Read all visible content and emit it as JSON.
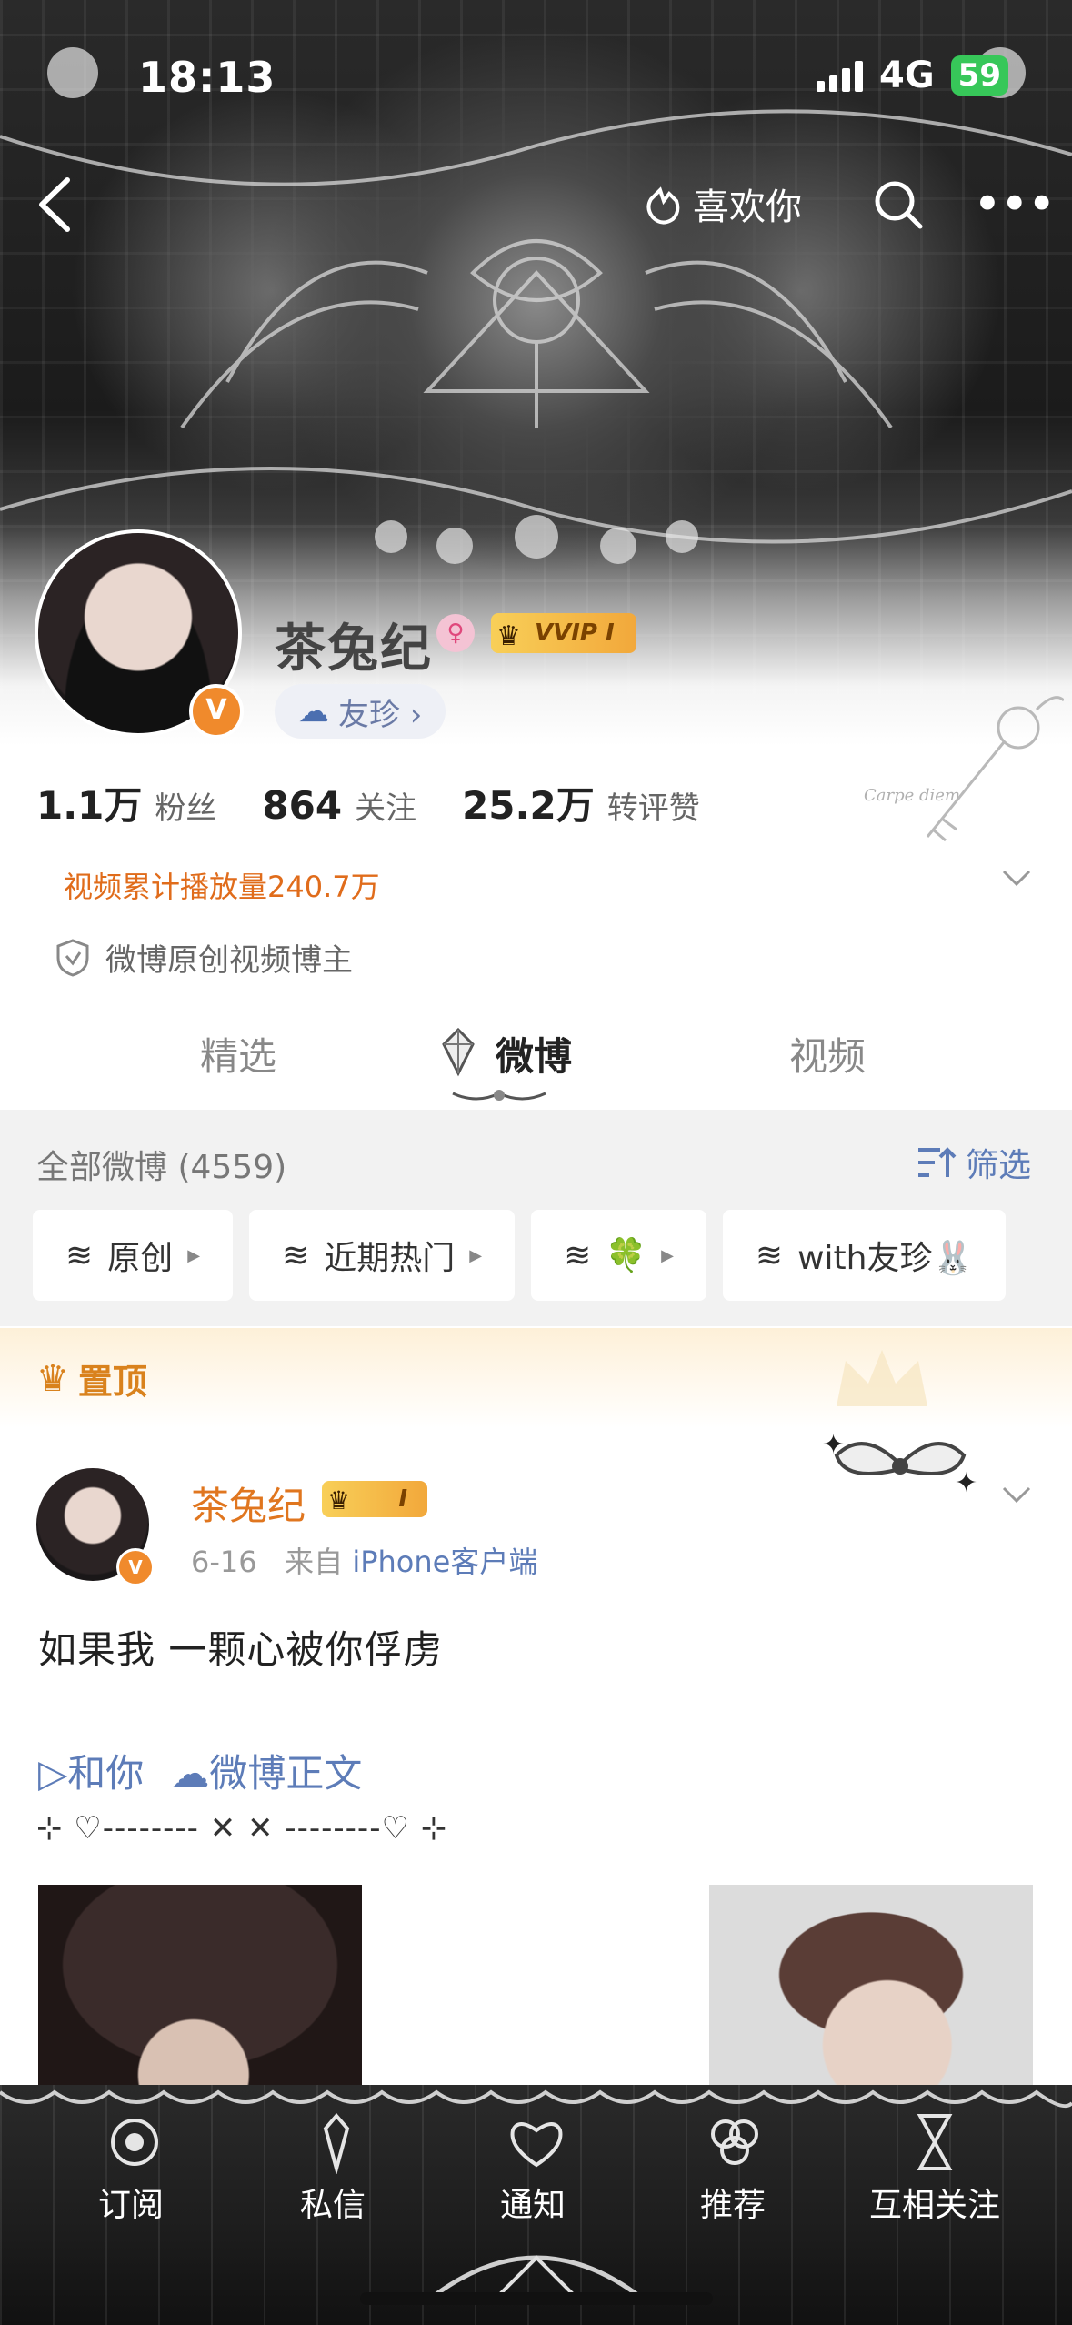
{
  "status_bar": {
    "time": "18:13",
    "network": "4G",
    "battery": "59"
  },
  "nav": {
    "like_label": "喜欢你"
  },
  "profile": {
    "name": "茶兔纪",
    "vvip_label": "VVIP I",
    "verify_badge": "V",
    "friend_chip": "友珍 ›",
    "stats": [
      {
        "num": "1.1万",
        "label": "粉丝"
      },
      {
        "num": "864",
        "label": "关注"
      },
      {
        "num": "25.2万",
        "label": "转评赞"
      }
    ],
    "video_count": "视频累计播放量240.7万",
    "verification": "微博原创视频博主",
    "key_caption": "Carpe diem"
  },
  "tabs": [
    {
      "label": "精选",
      "active": false
    },
    {
      "label": "微博",
      "active": true
    },
    {
      "label": "视频",
      "active": false
    }
  ],
  "filter": {
    "all_label": "全部微博 (4559)",
    "filter_label": "筛选",
    "chips": [
      "原创",
      "近期热门",
      "🍀",
      "with友珍🐰"
    ]
  },
  "pinned": {
    "label": "置顶",
    "post": {
      "author": "茶兔纪",
      "vip_label": "I",
      "date": "6-16",
      "source_prefix": "来自",
      "source": "iPhone客户端",
      "text": "如果我 一颗心被你俘虏",
      "links": [
        "▷和你",
        "微博正文"
      ],
      "deco_line": "⊹ ♡-------- ✕ ✕ --------♡ ⊹"
    }
  },
  "tabbar": {
    "items": [
      "订阅",
      "私信",
      "通知",
      "推荐",
      "互相关注"
    ]
  },
  "colors": {
    "accent_orange": "#e06c1b",
    "link_blue": "#5d7cb8",
    "vip_gold": "#f2a83b"
  }
}
